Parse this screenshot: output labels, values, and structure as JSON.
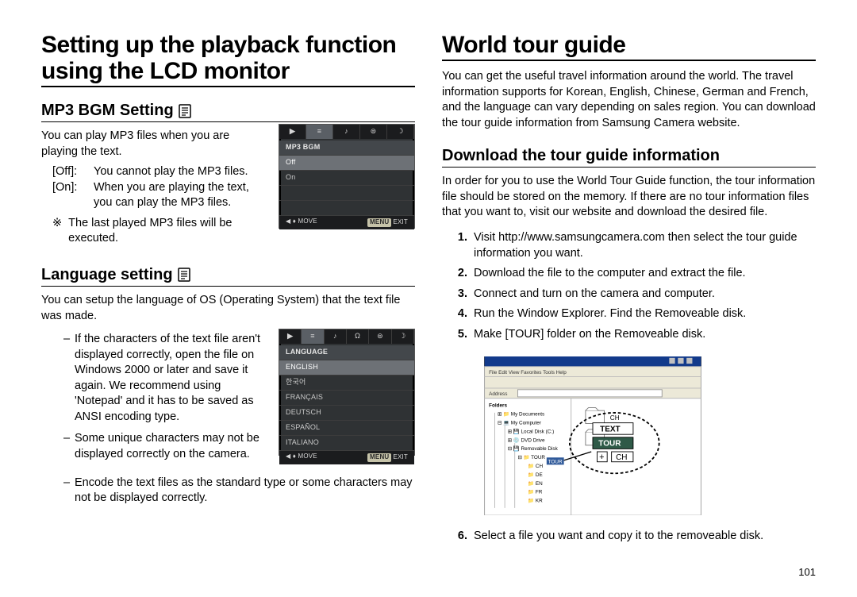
{
  "page_number": "101",
  "left": {
    "title": "Setting up the playback function using the LCD monitor",
    "section1": {
      "heading": "MP3 BGM Setting",
      "intro": "You can play MP3 files when you are playing the text.",
      "options": {
        "off_label": "[Off]:",
        "off_text": "You cannot play the MP3 files.",
        "on_label": "[On]:",
        "on_text": "When you are playing the text, you can play the MP3 files."
      },
      "note_mark": "※",
      "note": "The last played MP3 files will be executed.",
      "ss": {
        "header": "MP3 BGM",
        "row1": "Off",
        "row2": "On",
        "foot_move": "MOVE",
        "foot_menu": "MENU",
        "foot_exit": "EXIT"
      }
    },
    "section2": {
      "heading": "Language setting",
      "intro": "You can setup the language of OS (Operating System) that the text file was made.",
      "bullets": [
        "If the characters of the text file aren't displayed correctly, open the file on Windows 2000 or later and save it again. We recommend using 'Notepad' and it has to be saved as ANSI encoding type.",
        "Some unique characters may not be displayed correctly on the camera.",
        "Encode the text files as the standard type or some characters may not be displayed correctly."
      ],
      "ss": {
        "header": "LANGUAGE",
        "rows": [
          "ENGLISH",
          "한국어",
          "FRANÇAIS",
          "DEUTSCH",
          "ESPAÑOL",
          "ITALIANO"
        ],
        "foot_move": "MOVE",
        "foot_menu": "MENU",
        "foot_exit": "EXIT"
      }
    }
  },
  "right": {
    "title": "World tour guide",
    "intro": "You can get the useful travel information around the world. The travel information supports for Korean, English, Chinese, German and French, and the language can vary depending on sales region. You can download the tour guide information from Samsung Camera website.",
    "section": {
      "heading": "Download the tour guide information",
      "intro": "In order for you to use the World Tour Guide function, the tour information file should be stored on the memory. If there are no tour information files that you want to, visit our website and download the desired file.",
      "steps": [
        "Visit http://www.samsungcamera.com then select the tour guide information you want.",
        "Download the file to the computer and extract the file.",
        "Connect and turn on the camera and computer.",
        "Run the Window Explorer. Find the Removeable disk.",
        "Make [TOUR] folder on the Removeable disk.",
        "Select a file you want and copy it to the removeable disk."
      ],
      "explorer": {
        "label_text": "TEXT",
        "label_tour": "TOUR",
        "label_ch": "CH",
        "plus": "+"
      }
    }
  }
}
